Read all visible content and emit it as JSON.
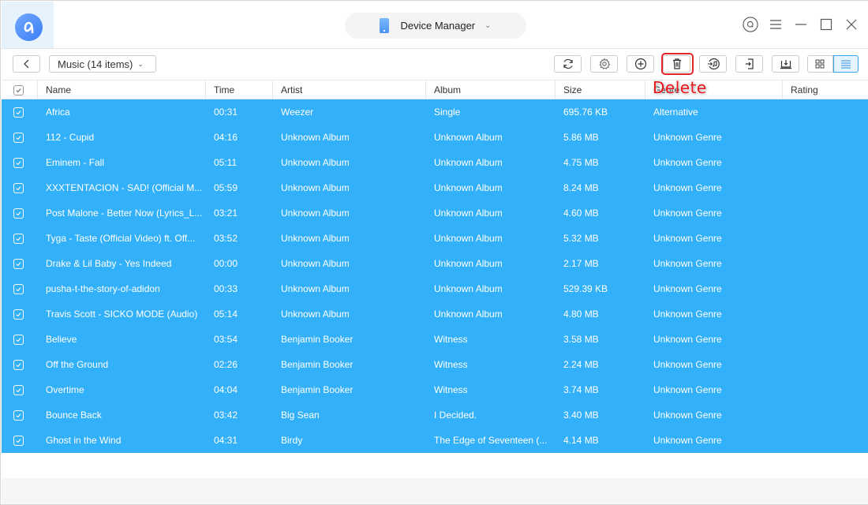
{
  "app": {
    "logo_icon": "app-logo-icon",
    "device_selector": {
      "label": "Device Manager",
      "icon": "phone-icon"
    },
    "window_controls": [
      "account-icon",
      "menu-icon",
      "minimize-icon",
      "maximize-icon",
      "close-icon"
    ]
  },
  "toolbar": {
    "back_icon": "chevron-left-icon",
    "category": "Music (14 items)",
    "buttons": [
      {
        "name": "refresh",
        "icon": "refresh-icon"
      },
      {
        "name": "settings",
        "icon": "gear-icon"
      },
      {
        "name": "add",
        "icon": "plus-circle-icon"
      },
      {
        "name": "delete",
        "icon": "trash-icon"
      },
      {
        "name": "to-itunes",
        "icon": "music-import-icon"
      },
      {
        "name": "to-pc",
        "icon": "export-icon"
      },
      {
        "name": "to-device",
        "icon": "download-to-device-icon"
      }
    ],
    "views": [
      {
        "name": "grid",
        "icon": "grid-icon",
        "active": false
      },
      {
        "name": "list",
        "icon": "list-icon",
        "active": true
      }
    ]
  },
  "annotation": {
    "callout": "Delete",
    "color": "#e5242a"
  },
  "table": {
    "columns": [
      "Name",
      "Time",
      "Artist",
      "Album",
      "Size",
      "Genre",
      "Rating"
    ],
    "all_selected": true,
    "selection_color": "#33b0fa",
    "rows": [
      {
        "name": "Africa",
        "time": "00:31",
        "artist": "Weezer",
        "album": "Single",
        "size": "695.76 KB",
        "genre": "Alternative",
        "rating": ""
      },
      {
        "name": "112 - Cupid",
        "time": "04:16",
        "artist": "Unknown Album",
        "album": "Unknown Album",
        "size": "5.86 MB",
        "genre": "Unknown Genre",
        "rating": ""
      },
      {
        "name": "Eminem - Fall",
        "time": "05:11",
        "artist": "Unknown Album",
        "album": "Unknown Album",
        "size": "4.75 MB",
        "genre": "Unknown Genre",
        "rating": ""
      },
      {
        "name": "XXXTENTACION - SAD! (Official M...",
        "time": "05:59",
        "artist": "Unknown Album",
        "album": "Unknown Album",
        "size": "8.24 MB",
        "genre": "Unknown Genre",
        "rating": ""
      },
      {
        "name": "Post Malone - Better Now (Lyrics_L...",
        "time": "03:21",
        "artist": "Unknown Album",
        "album": "Unknown Album",
        "size": "4.60 MB",
        "genre": "Unknown Genre",
        "rating": ""
      },
      {
        "name": "Tyga - Taste (Official Video) ft. Off...",
        "time": "03:52",
        "artist": "Unknown Album",
        "album": "Unknown Album",
        "size": "5.32 MB",
        "genre": "Unknown Genre",
        "rating": ""
      },
      {
        "name": "Drake & Lil Baby - Yes Indeed",
        "time": "00:00",
        "artist": "Unknown Album",
        "album": "Unknown Album",
        "size": "2.17 MB",
        "genre": "Unknown Genre",
        "rating": ""
      },
      {
        "name": "pusha-t-the-story-of-adidon",
        "time": "00:33",
        "artist": "Unknown Album",
        "album": "Unknown Album",
        "size": "529.39 KB",
        "genre": "Unknown Genre",
        "rating": ""
      },
      {
        "name": "Travis Scott - SICKO MODE (Audio)",
        "time": "05:14",
        "artist": "Unknown Album",
        "album": "Unknown Album",
        "size": "4.80 MB",
        "genre": "Unknown Genre",
        "rating": ""
      },
      {
        "name": "Believe",
        "time": "03:54",
        "artist": "Benjamin Booker",
        "album": "Witness",
        "size": "3.58 MB",
        "genre": "Unknown Genre",
        "rating": ""
      },
      {
        "name": "Off the Ground",
        "time": "02:26",
        "artist": "Benjamin Booker",
        "album": "Witness",
        "size": "2.24 MB",
        "genre": "Unknown Genre",
        "rating": ""
      },
      {
        "name": "Overtime",
        "time": "04:04",
        "artist": "Benjamin Booker",
        "album": "Witness",
        "size": "3.74 MB",
        "genre": "Unknown Genre",
        "rating": ""
      },
      {
        "name": "Bounce Back",
        "time": "03:42",
        "artist": "Big Sean",
        "album": "I Decided.",
        "size": "3.40 MB",
        "genre": "Unknown Genre",
        "rating": ""
      },
      {
        "name": "Ghost in the Wind",
        "time": "04:31",
        "artist": "Birdy",
        "album": "The Edge of Seventeen (...",
        "size": "4.14 MB",
        "genre": "Unknown Genre",
        "rating": ""
      }
    ]
  }
}
